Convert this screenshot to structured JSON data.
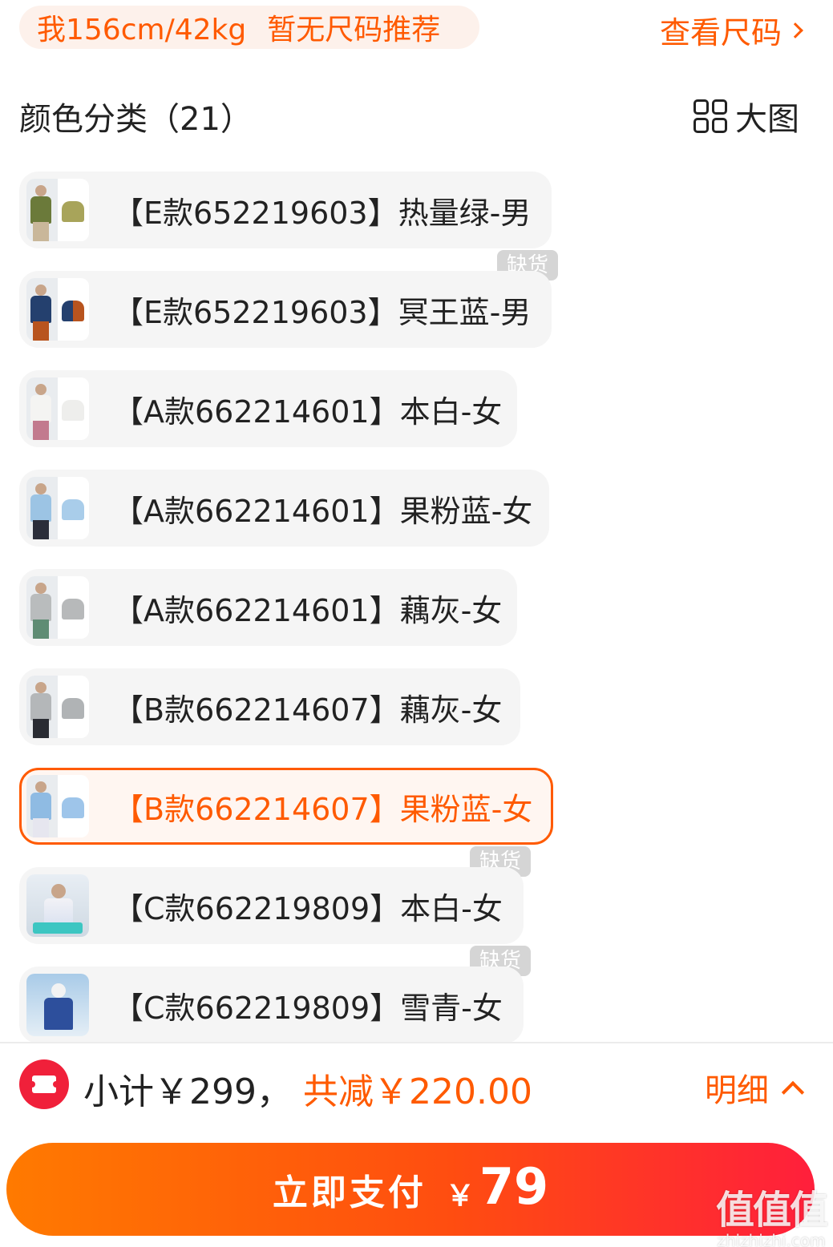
{
  "size_bar": {
    "body_info": "我156cm/42kg",
    "recommendation": "暂无尺码推荐",
    "size_chart_link": "查看尺码"
  },
  "color_section": {
    "title": "颜色分类（21）",
    "big_view_label": "大图"
  },
  "options": [
    {
      "label": "【E款652219603】热量绿-男",
      "out_of_stock": false,
      "selected": false
    },
    {
      "label": "【E款652219603】冥王蓝-男",
      "out_of_stock": true,
      "selected": false
    },
    {
      "label": "【A款662214601】本白-女",
      "out_of_stock": false,
      "selected": false
    },
    {
      "label": "【A款662214601】果粉蓝-女",
      "out_of_stock": false,
      "selected": false
    },
    {
      "label": "【A款662214601】藕灰-女",
      "out_of_stock": false,
      "selected": false
    },
    {
      "label": "【B款662214607】藕灰-女",
      "out_of_stock": false,
      "selected": false
    },
    {
      "label": "【B款662214607】果粉蓝-女",
      "out_of_stock": false,
      "selected": true
    },
    {
      "label": "【C款662219809】本白-女",
      "out_of_stock": true,
      "selected": false
    },
    {
      "label": "【C款662219809】雪青-女",
      "out_of_stock": true,
      "selected": false
    }
  ],
  "out_of_stock_label": "缺货",
  "summary": {
    "subtotal": "小计￥299，",
    "discount": "共减￥220.00",
    "detail_label": "明细"
  },
  "pay": {
    "label": "立即支付",
    "currency": "￥",
    "amount": "79"
  },
  "watermark": {
    "main": "值值值",
    "sub": "zhizhizhi.com"
  },
  "colors": {
    "accent": "#ff5a00",
    "coupon_red": "#f0203a",
    "chip_bg": "#f5f5f5",
    "tag_gray": "#d5d5d5"
  }
}
